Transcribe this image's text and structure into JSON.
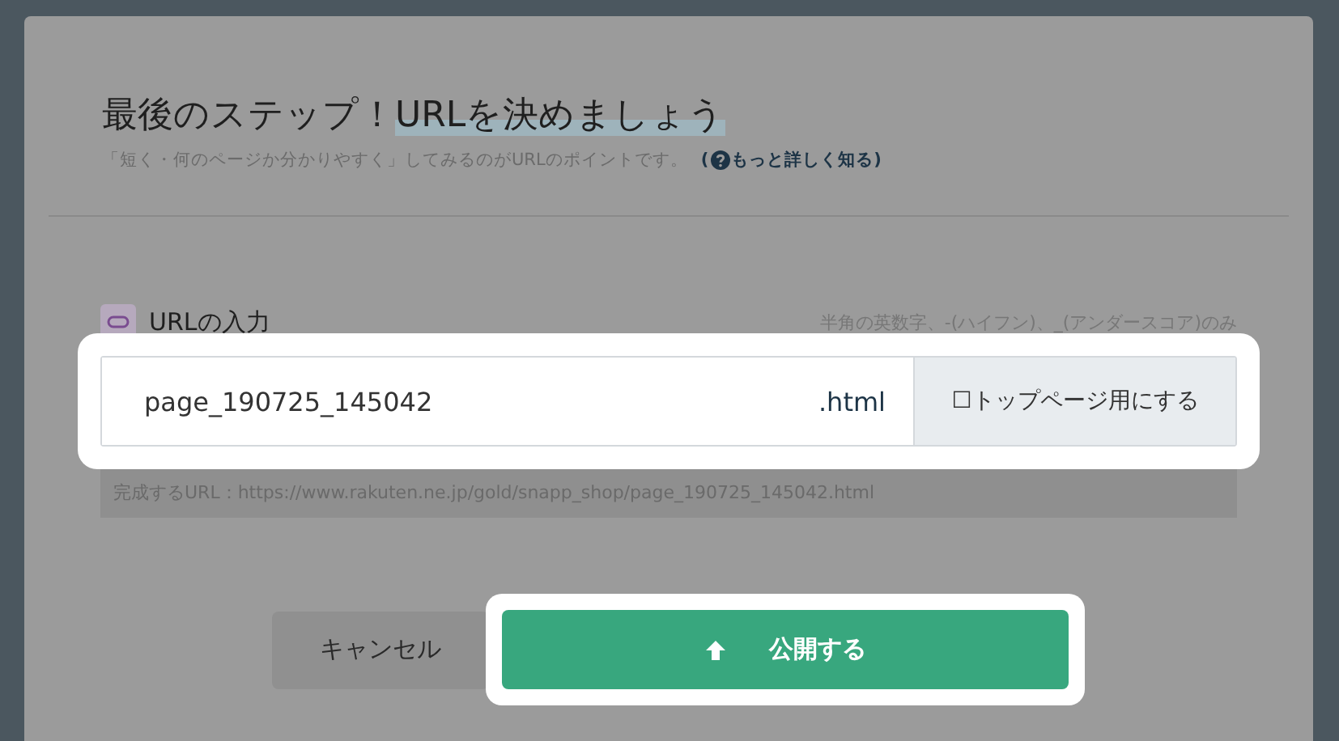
{
  "dialog": {
    "title_plain": "最後のステップ！",
    "title_highlight": "URLを決めましょう",
    "subtitle": "「短く・何のページか分かりやすく」してみるのがURLのポイントです。",
    "help_link": "もっと詳しく知る)",
    "help_prefix": "(",
    "url_section": {
      "label": "URLの入力",
      "hint": "半角の英数字、-(ハイフン)、_(アンダースコア)のみ",
      "value": "page_190725_145042",
      "suffix": ".html",
      "top_page_option": "☐トップページ用にする",
      "result": "完成するURL：https://www.rakuten.ne.jp/gold/snapp_shop/page_190725_145042.html"
    },
    "buttons": [
      {
        "kind": "cancel",
        "label": "キャンセル"
      },
      {
        "kind": "primary",
        "label": "公開する"
      }
    ]
  }
}
